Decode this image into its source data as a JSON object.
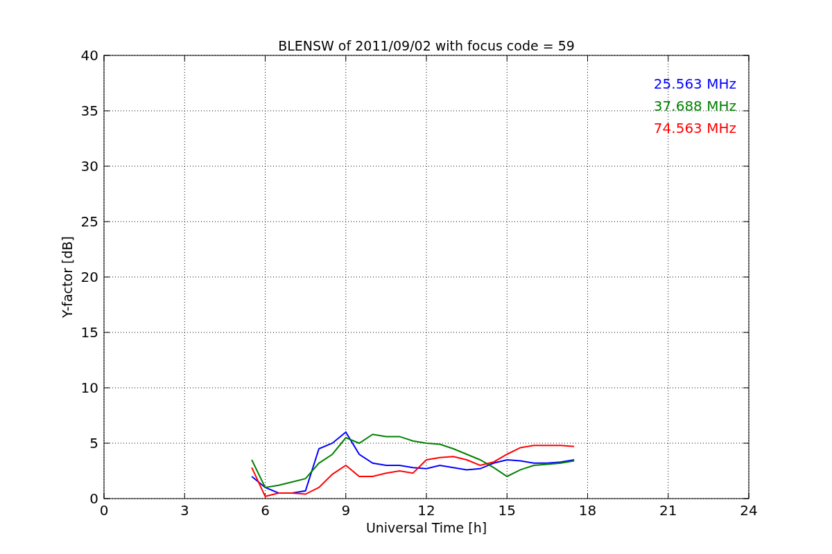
{
  "chart_data": {
    "type": "line",
    "title": "BLENSW of 2011/09/02 with focus code = 59",
    "xlabel": "Universal Time [h]",
    "ylabel": "Y-factor [dB]",
    "x": [
      5.5,
      6,
      6.5,
      7,
      7.5,
      8,
      8.5,
      9,
      9.5,
      10,
      10.5,
      11,
      11.5,
      12,
      12.5,
      13,
      13.5,
      14,
      14.5,
      15,
      15.5,
      16,
      16.5,
      17,
      17.5
    ],
    "series": [
      {
        "name": "25.563 MHz",
        "color": "#0000ff",
        "values": [
          2.0,
          1.0,
          0.5,
          0.5,
          0.7,
          4.5,
          5,
          6,
          4,
          3.2,
          3,
          3,
          2.8,
          2.7,
          3,
          2.8,
          2.6,
          2.7,
          3.2,
          3.5,
          3.4,
          3.2,
          3.2,
          3.3,
          3.5
        ]
      },
      {
        "name": "37.688 MHz",
        "color": "#008000",
        "values": [
          3.5,
          1.0,
          1.2,
          1.5,
          1.8,
          3.2,
          4,
          5.5,
          5,
          5.8,
          5.6,
          5.6,
          5.2,
          5.0,
          4.9,
          4.5,
          4.0,
          3.5,
          2.8,
          2.0,
          2.6,
          3.0,
          3.1,
          3.2,
          3.4
        ]
      },
      {
        "name": "74.563 MHz",
        "color": "#ff0000",
        "values": [
          2.8,
          0.2,
          0.5,
          0.5,
          0.4,
          1.0,
          2.2,
          3.0,
          2.0,
          2.0,
          2.3,
          2.5,
          2.3,
          3.5,
          3.7,
          3.8,
          3.5,
          3.0,
          3.3,
          4.0,
          4.6,
          4.8,
          4.8,
          4.8,
          4.7
        ]
      }
    ],
    "xlim": [
      0,
      24
    ],
    "ylim": [
      0,
      40
    ],
    "xticks": [
      0,
      3,
      6,
      9,
      12,
      15,
      18,
      21,
      24
    ],
    "yticks": [
      0,
      5,
      10,
      15,
      20,
      25,
      30,
      35,
      40
    ],
    "grid": true
  }
}
